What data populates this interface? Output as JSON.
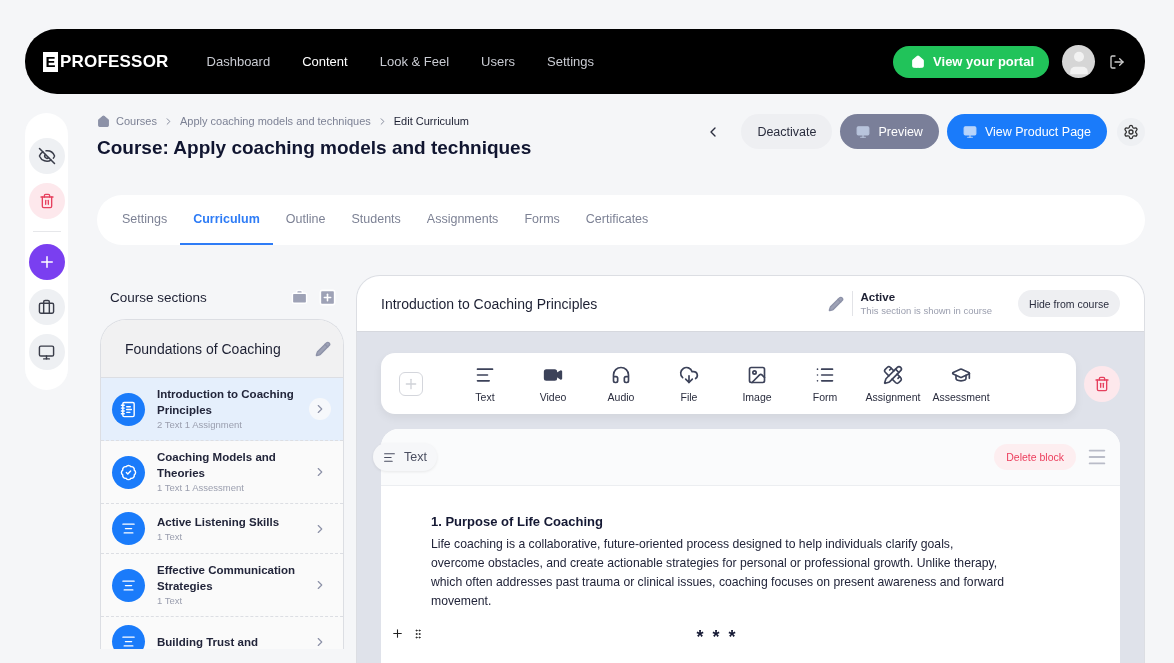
{
  "header": {
    "logo": {
      "mark": "E",
      "text": "PROFESSOR"
    },
    "nav": [
      {
        "label": "Dashboard",
        "selected": false
      },
      {
        "label": "Content",
        "selected": true
      },
      {
        "label": "Look & Feel",
        "selected": false
      },
      {
        "label": "Users",
        "selected": false
      },
      {
        "label": "Settings",
        "selected": false
      }
    ],
    "portal_button": "View your portal"
  },
  "breadcrumb": [
    "Courses",
    "Apply coaching models and techniques",
    "Edit Curriculum"
  ],
  "title": "Course: Apply coaching models and techniques",
  "actions": {
    "deactivate": "Deactivate",
    "preview": "Preview",
    "product_page": "View Product Page"
  },
  "tabs": [
    {
      "label": "Settings",
      "selected": false
    },
    {
      "label": "Curriculum",
      "selected": true
    },
    {
      "label": "Outline",
      "selected": false
    },
    {
      "label": "Students",
      "selected": false
    },
    {
      "label": "Assignments",
      "selected": false
    },
    {
      "label": "Forms",
      "selected": false
    },
    {
      "label": "Certificates",
      "selected": false
    }
  ],
  "course_sections": {
    "heading": "Course sections",
    "group": "Foundations of Coaching",
    "items": [
      {
        "kind": "notes",
        "title": "Introduction to Coaching Principles",
        "meta": "2 Text 1 Assignment",
        "selected": true
      },
      {
        "kind": "badge",
        "title": "Coaching Models and Theories",
        "meta": "1 Text 1 Assessment",
        "selected": false
      },
      {
        "kind": "text",
        "title": "Active Listening Skills",
        "meta": "1 Text",
        "selected": false
      },
      {
        "kind": "text",
        "title": "Effective Communication Strategies",
        "meta": "1 Text",
        "selected": false
      },
      {
        "kind": "text",
        "title": "Building Trust and",
        "selected": false
      }
    ]
  },
  "editor": {
    "section_title": "Introduction to Coaching Principles",
    "status": "Active",
    "status_note": "This section is shown in course",
    "hide_button": "Hide from course",
    "blocks": [
      {
        "kind": "text",
        "label": "Text"
      },
      {
        "kind": "video",
        "label": "Video"
      },
      {
        "kind": "audio",
        "label": "Audio"
      },
      {
        "kind": "file",
        "label": "File"
      },
      {
        "kind": "image",
        "label": "Image"
      },
      {
        "kind": "form",
        "label": "Form"
      },
      {
        "kind": "assignment",
        "label": "Assignment"
      },
      {
        "kind": "assessment",
        "label": "Assessment"
      }
    ],
    "block": {
      "type_label": "Text",
      "delete": "Delete block",
      "heading": "1. Purpose of Life Coaching",
      "body": "Life coaching is a collaborative, future-oriented process designed to help individuals clarify goals, overcome obstacles, and create actionable strategies for personal or professional growth. Unlike therapy, which often addresses past trauma or clinical issues, coaching focuses on present awareness and forward movement.",
      "separator": "* * *"
    }
  }
}
